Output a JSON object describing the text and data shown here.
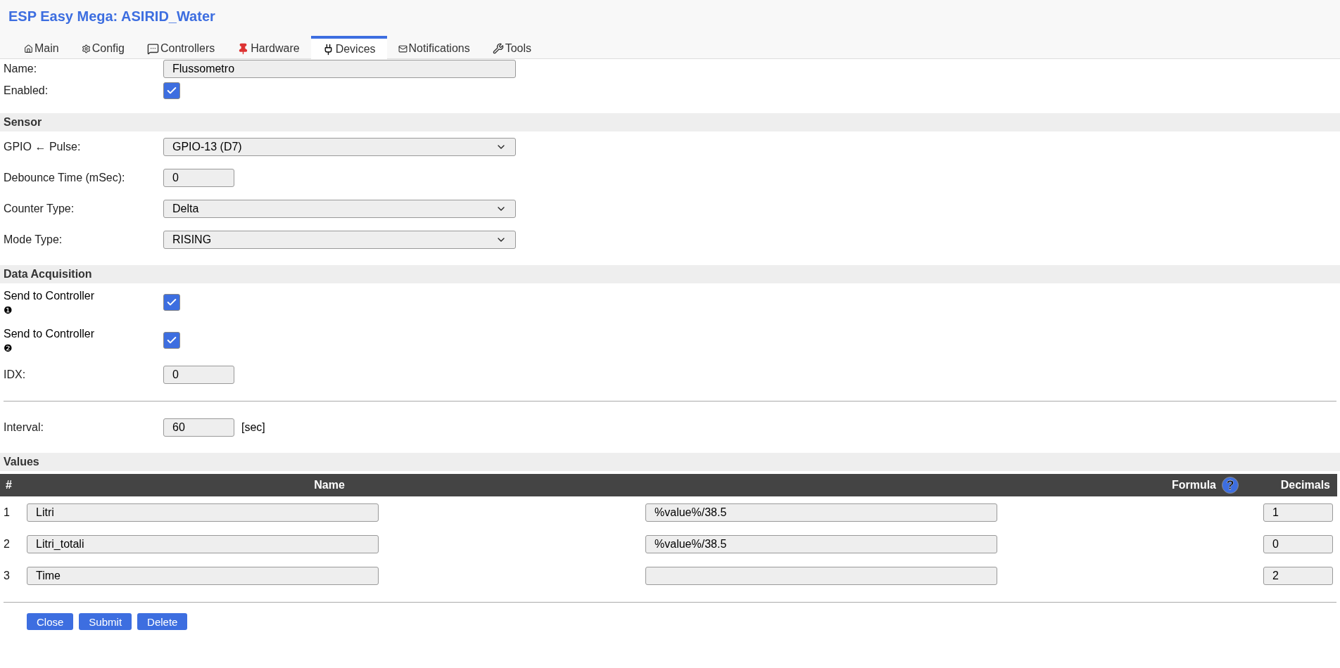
{
  "title": "ESP Easy Mega: ASIRID_Water",
  "tabs": [
    {
      "label": "Main",
      "selected": false
    },
    {
      "label": "Config",
      "selected": false
    },
    {
      "label": "Controllers",
      "selected": false
    },
    {
      "label": "Hardware",
      "selected": false
    },
    {
      "label": "Devices",
      "selected": true
    },
    {
      "label": "Notifications",
      "selected": false
    },
    {
      "label": "Tools",
      "selected": false
    }
  ],
  "form": [
    {
      "kind": "text",
      "label": "Name:",
      "value": "Flussometro"
    },
    {
      "kind": "checkbox",
      "label": "Enabled:",
      "checked": true
    },
    {
      "kind": "section",
      "title": "Sensor"
    },
    {
      "kind": "select",
      "label": "GPIO ← Pulse:",
      "value": "GPIO-13 (D7)"
    },
    {
      "kind": "number",
      "label": "Debounce Time (mSec):",
      "value": "0"
    },
    {
      "kind": "select",
      "label": "Counter Type:",
      "value": "Delta"
    },
    {
      "kind": "select",
      "label": "Mode Type:",
      "value": "RISING"
    },
    {
      "kind": "section",
      "title": "Data Acquisition"
    },
    {
      "kind": "checkbox",
      "label": "Send to Controller",
      "marker": "❶",
      "checked": true
    },
    {
      "kind": "checkbox",
      "label": "Send to Controller",
      "marker": "❷",
      "checked": true
    },
    {
      "kind": "number",
      "label": "IDX:",
      "value": "0"
    },
    {
      "kind": "rule"
    },
    {
      "kind": "number",
      "label": "Interval:",
      "value": "60",
      "unit": "[sec]"
    },
    {
      "kind": "section",
      "title": "Values"
    }
  ],
  "values_table": {
    "columns": [
      {
        "label": "#"
      },
      {
        "label": "Name"
      },
      {
        "label": "Formula",
        "help": "?"
      },
      {
        "label": "Decimals"
      }
    ],
    "rows": [
      {
        "index": "1",
        "name": "Litri",
        "formula": "%value%/38.5",
        "decimals": "1"
      },
      {
        "index": "2",
        "name": "Litri_totali",
        "formula": "%value%/38.5",
        "decimals": "0"
      },
      {
        "index": "3",
        "name": "Time",
        "decimals": "2"
      }
    ]
  },
  "buttons": [
    "Close",
    "Submit",
    "Delete"
  ]
}
